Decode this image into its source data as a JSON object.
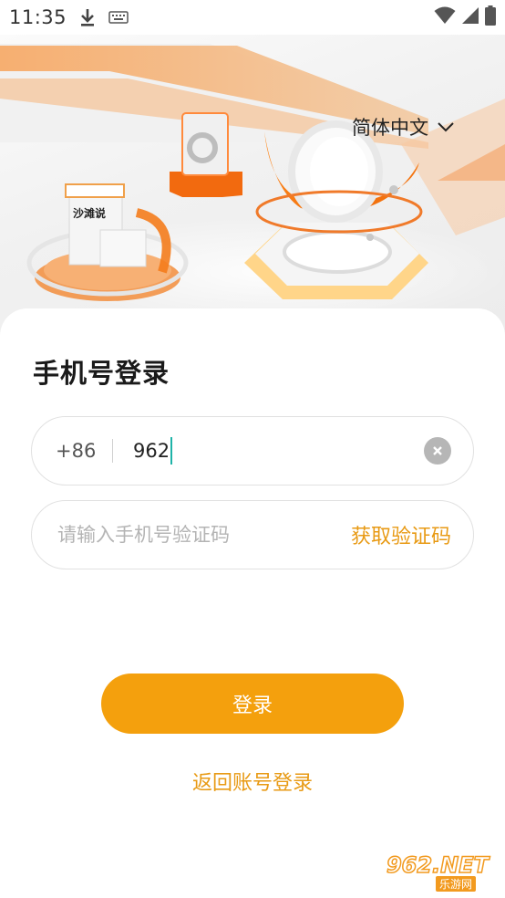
{
  "status_bar": {
    "time": "11:35",
    "download_icon": "download-icon",
    "keyboard_icon": "keyboard-icon",
    "wifi_icon": "wifi-icon",
    "signal_icon": "signal-icon",
    "battery_icon": "battery-icon"
  },
  "hero": {
    "language_label": "简体中文",
    "sign_text": "沙滩说"
  },
  "login": {
    "title": "手机号登录",
    "country_code": "+86",
    "phone_value": "962",
    "code_placeholder": "请输入手机号验证码",
    "get_code_label": "获取验证码",
    "submit_label": "登录",
    "back_label": "返回账号登录"
  },
  "watermark": {
    "main": "962.NET",
    "sub": "乐游网"
  },
  "colors": {
    "accent": "#f4a00d",
    "link": "#e89a14",
    "caret": "#1fb3a8"
  }
}
